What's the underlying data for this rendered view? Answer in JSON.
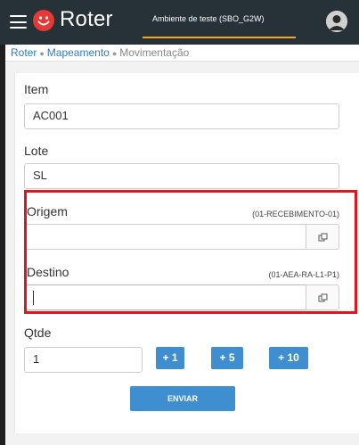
{
  "app": {
    "logo_text": "Roter",
    "environment": "Ambiente de teste (SBO_G2W)",
    "colors": {
      "topbar": "#263238",
      "logo": "#e53935",
      "accent": "#f5a623",
      "primary": "#3e8ed0",
      "highlight": "#e3141b"
    }
  },
  "icons": {
    "menu": "hamburger-icon",
    "logo": "smile-logo-icon",
    "avatar": "user-avatar-icon",
    "lookup": "copy-icon"
  },
  "breadcrumb": {
    "items": [
      "Roter",
      "Mapeamento",
      "Movimentação"
    ]
  },
  "form": {
    "item": {
      "label": "Item",
      "value": "AC001"
    },
    "lote": {
      "label": "Lote",
      "value": "SL"
    },
    "origem": {
      "label": "Origem",
      "hint": "(01-RECEBIMENTO-01)",
      "value": ""
    },
    "destino": {
      "label": "Destino",
      "hint": "(01-AEA-RA-L1-P1)",
      "value": ""
    },
    "qtde": {
      "label": "Qtde",
      "value": "1"
    },
    "steps": [
      "+ 1",
      "+ 5",
      "+ 10"
    ],
    "submit_label": "ENVIAR"
  }
}
